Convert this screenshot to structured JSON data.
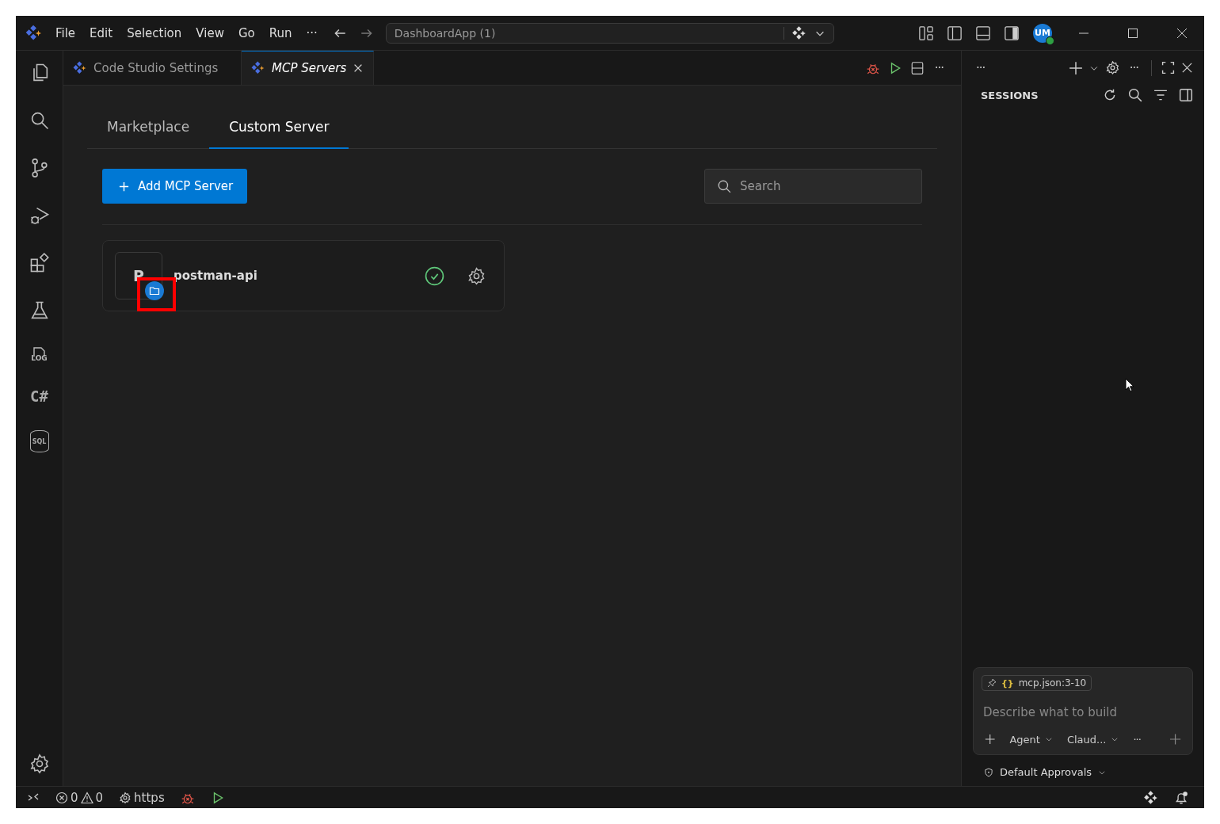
{
  "title_bar": {
    "menu": [
      "File",
      "Edit",
      "Selection",
      "View",
      "Go",
      "Run"
    ],
    "more": "···",
    "command_center": "DashboardApp (1)",
    "avatar": "UM",
    "avatar_online": true
  },
  "activity_bar": {
    "log_label": "LOG",
    "csharp_label": "C#",
    "sql_label": "SQL"
  },
  "tabs": [
    {
      "label": "Code Studio Settings",
      "selected": false
    },
    {
      "label": "MCP Servers",
      "selected": true
    }
  ],
  "editor_actions": {
    "more": "···"
  },
  "page_tabs": [
    {
      "label": "Marketplace",
      "selected": false
    },
    {
      "label": "Custom Server",
      "selected": true
    }
  ],
  "add_button": "Add MCP Server",
  "search": {
    "placeholder": "Search"
  },
  "servers": [
    {
      "initial": "P",
      "name": "postman-api",
      "connected": true
    }
  ],
  "sessions": {
    "header_more": "···",
    "header_more_2": "···",
    "title": "SESSIONS"
  },
  "chat": {
    "context_chip": "mcp.json:3-10",
    "braces": "{}",
    "placeholder": "Describe what to build",
    "mode": "Agent",
    "model": "Claud...",
    "more": "···",
    "approvals": "Default Approvals"
  },
  "status_bar": {
    "errors": "0",
    "warnings": "0",
    "label": "https"
  }
}
